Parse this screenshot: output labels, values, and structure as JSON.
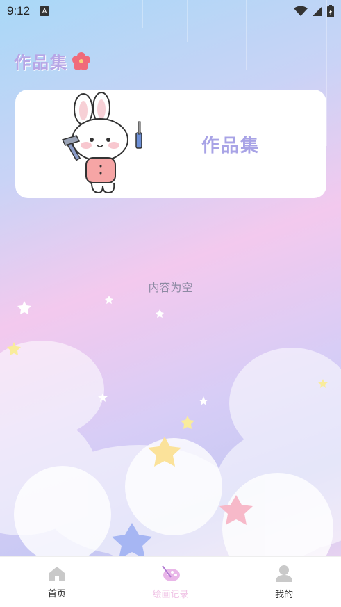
{
  "status_bar": {
    "time": "9:12",
    "notification_icon": "a-icon",
    "icons": [
      "wifi-icon",
      "signal-icon",
      "battery-icon"
    ]
  },
  "header": {
    "title": "作品集",
    "icon": "flower-icon"
  },
  "card": {
    "title": "作品集",
    "illustration": "bunny-with-tools-icon"
  },
  "main": {
    "empty_text": "内容为空"
  },
  "tabs": [
    {
      "label": "首页",
      "icon": "home-icon",
      "active": false
    },
    {
      "label": "绘画记录",
      "icon": "palette-icon",
      "active": true
    },
    {
      "label": "我的",
      "icon": "user-icon",
      "active": false
    }
  ],
  "colors": {
    "accent": "#f0c4e6",
    "title": "#a8a3e6",
    "empty_text": "#8d8aa3"
  }
}
